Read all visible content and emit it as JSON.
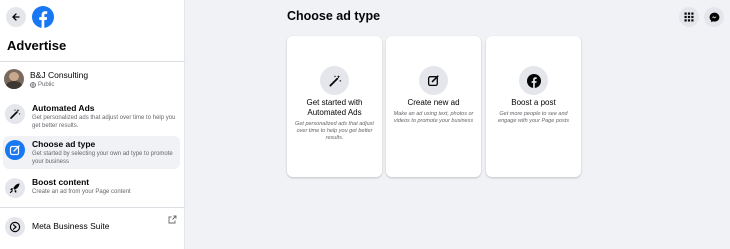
{
  "sidebar": {
    "title": "Advertise",
    "page": {
      "name": "B&J Consulting",
      "visibility": "Public"
    },
    "items": [
      {
        "title": "Automated Ads",
        "desc": "Get personalized ads that adjust over time to help you get better results."
      },
      {
        "title": "Choose ad type",
        "desc": "Get started by selecting your own ad type to promote your business"
      },
      {
        "title": "Boost content",
        "desc": "Create an ad from your Page content"
      },
      {
        "title": "Meta Business Suite"
      }
    ]
  },
  "main": {
    "title": "Choose ad type",
    "cards": [
      {
        "title": "Get started with Automated Ads",
        "desc": "Get personalized ads that adjust over time to help you get better results."
      },
      {
        "title": "Create new ad",
        "desc": "Make an ad using text, photos or videos to promote your business"
      },
      {
        "title": "Boost a post",
        "desc": "Get more people to see and engage with your Page posts"
      }
    ]
  },
  "icons": {
    "back": "back-arrow-icon",
    "logo": "facebook-logo-icon",
    "apps": "grid-menu-icon",
    "messenger": "messenger-icon"
  },
  "colors": {
    "accent": "#1877f2",
    "background": "#f0f2f5"
  }
}
